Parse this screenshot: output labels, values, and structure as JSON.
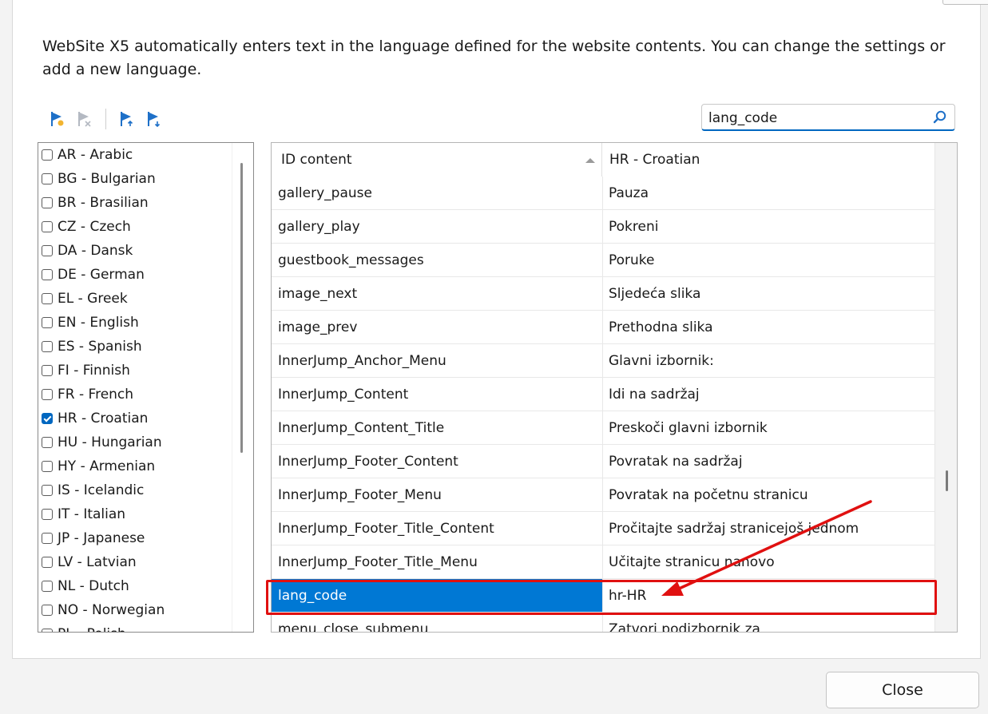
{
  "description": "WebSite X5 automatically enters text in the language defined for the website contents. You can change the settings or add a new language.",
  "toolbar": {
    "icons": [
      "flag-add-icon",
      "flag-remove-icon",
      "flag-import-icon",
      "flag-export-icon"
    ]
  },
  "search": {
    "value": "lang_code"
  },
  "languages": [
    {
      "label": "AR - Arabic",
      "checked": false
    },
    {
      "label": "BG - Bulgarian",
      "checked": false
    },
    {
      "label": "BR - Brasilian",
      "checked": false
    },
    {
      "label": "CZ - Czech",
      "checked": false
    },
    {
      "label": "DA - Dansk",
      "checked": false
    },
    {
      "label": "DE - German",
      "checked": false
    },
    {
      "label": "EL - Greek",
      "checked": false
    },
    {
      "label": "EN - English",
      "checked": false
    },
    {
      "label": "ES - Spanish",
      "checked": false
    },
    {
      "label": "FI - Finnish",
      "checked": false
    },
    {
      "label": "FR - French",
      "checked": false
    },
    {
      "label": "HR - Croatian",
      "checked": true
    },
    {
      "label": "HU - Hungarian",
      "checked": false
    },
    {
      "label": "HY - Armenian",
      "checked": false
    },
    {
      "label": "IS - Icelandic",
      "checked": false
    },
    {
      "label": "IT - Italian",
      "checked": false
    },
    {
      "label": "JP - Japanese",
      "checked": false
    },
    {
      "label": "LV - Latvian",
      "checked": false
    },
    {
      "label": "NL - Dutch",
      "checked": false
    },
    {
      "label": "NO - Norwegian",
      "checked": false
    },
    {
      "label": "PL - Polish",
      "checked": false
    }
  ],
  "table": {
    "col_id": "ID content",
    "col_lang": "HR - Croatian",
    "rows": [
      {
        "id": "gallery_pause",
        "value": "Pauza"
      },
      {
        "id": "gallery_play",
        "value": "Pokreni"
      },
      {
        "id": "guestbook_messages",
        "value": "Poruke"
      },
      {
        "id": "image_next",
        "value": "Sljedeća slika"
      },
      {
        "id": "image_prev",
        "value": "Prethodna slika"
      },
      {
        "id": "InnerJump_Anchor_Menu",
        "value": "Glavni izbornik:"
      },
      {
        "id": "InnerJump_Content",
        "value": "Idi na sadržaj"
      },
      {
        "id": "InnerJump_Content_Title",
        "value": "Preskoči glavni izbornik"
      },
      {
        "id": "InnerJump_Footer_Content",
        "value": "Povratak na sadržaj"
      },
      {
        "id": "InnerJump_Footer_Menu",
        "value": "Povratak na početnu stranicu"
      },
      {
        "id": "InnerJump_Footer_Title_Content",
        "value": "Pročitajte sadržaj stranicejoš jednom"
      },
      {
        "id": "InnerJump_Footer_Title_Menu",
        "value": "Učitajte stranicu nanovo"
      },
      {
        "id": "lang_code",
        "value": "hr-HR",
        "selected": true
      },
      {
        "id": "menu_close_submenu",
        "value": "Zatvori podizbornik za"
      }
    ]
  },
  "close_label": "Close",
  "colors": {
    "accent": "#0078d4",
    "annotation": "#e01010"
  }
}
